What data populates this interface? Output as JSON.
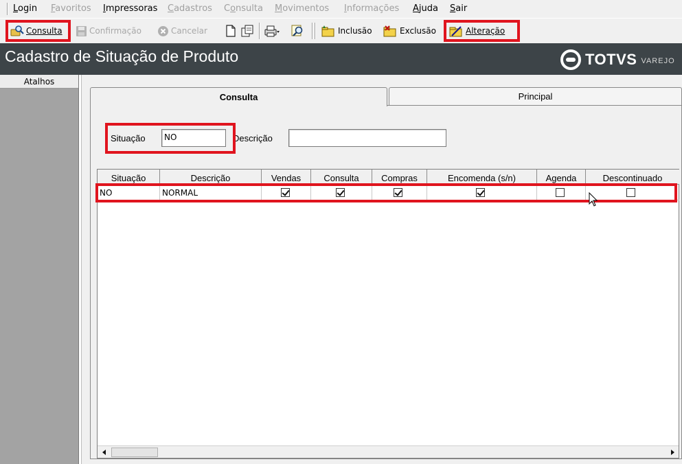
{
  "menu": {
    "items": [
      {
        "label": "Login",
        "enabled": true
      },
      {
        "label": "Favoritos",
        "enabled": false
      },
      {
        "label": "Impressoras",
        "enabled": true
      },
      {
        "label": "Cadastros",
        "enabled": false
      },
      {
        "label": "Consulta",
        "enabled": false
      },
      {
        "label": "Movimentos",
        "enabled": false
      },
      {
        "label": "Informações",
        "enabled": false
      },
      {
        "label": "Ajuda",
        "enabled": true
      },
      {
        "label": "Sair",
        "enabled": true
      }
    ]
  },
  "toolbar": {
    "consulta_label": "Consulta",
    "confirmacao_label": "Confirmação",
    "cancelar_label": "Cancelar",
    "inclusao_label": "Inclusão",
    "exclusao_label": "Exclusão",
    "alteracao_label": "Alteração"
  },
  "window": {
    "title": "Cadastro de Situação de Produto",
    "brand": "TOTVS",
    "brand_sub": "VAREJO"
  },
  "sidebar": {
    "header": "Atalhos"
  },
  "tabs": [
    {
      "label": "Consulta",
      "active": true
    },
    {
      "label": "Principal",
      "active": false
    }
  ],
  "filters": {
    "situacao_label": "Situação",
    "situacao_value": "NO",
    "descricao_label": "Descrição",
    "descricao_value": ""
  },
  "grid": {
    "columns": [
      "Situação",
      "Descrição",
      "Vendas",
      "Consulta",
      "Compras",
      "Encomenda (s/n)",
      "Agenda",
      "Descontinuado"
    ],
    "rows": [
      {
        "situacao": "NO",
        "descricao": "NORMAL",
        "vendas": true,
        "consulta": true,
        "compras": true,
        "encomenda": true,
        "agenda": false,
        "descontinuado": false
      }
    ]
  },
  "highlight_color": "#e0141e",
  "icons": [
    "consulta-icon",
    "save-icon",
    "cancel-icon",
    "new-document-icon",
    "copy-document-icon",
    "print-icon",
    "search-icon",
    "inclusao-icon",
    "exclusao-icon",
    "alteracao-icon"
  ]
}
